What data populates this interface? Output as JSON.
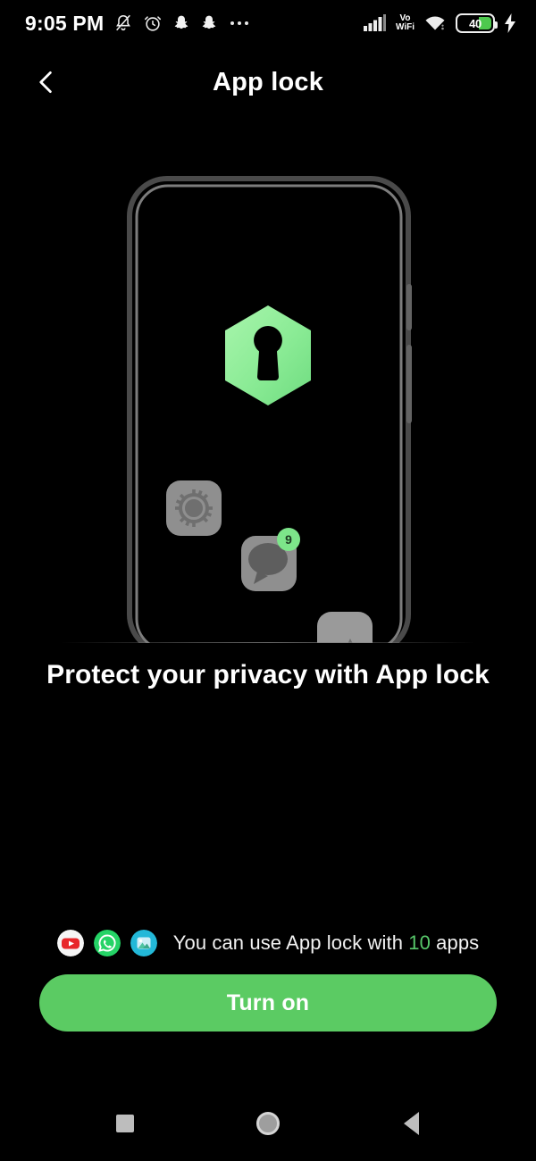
{
  "statusbar": {
    "time": "9:05 PM",
    "battery_level": "40",
    "vo_line1": "Vo",
    "vo_line2": "WiFi",
    "icons": [
      "bell-muted-icon",
      "alarm-clock-icon",
      "snapchat-icon",
      "snapchat-icon",
      "overflow-dots-icon",
      "signal-bars-icon",
      "volte-wifi-icon",
      "wifi-icon",
      "battery-icon",
      "charging-bolt-icon"
    ]
  },
  "header": {
    "title": "App lock",
    "back_icon": "chevron-left-icon"
  },
  "illustration": {
    "shield_icon": "shield-keyhole-icon",
    "app_tiles": [
      {
        "name": "settings-gear-icon"
      },
      {
        "name": "messages-bubble-icon",
        "badge": "9"
      },
      {
        "name": "gallery-icon"
      }
    ]
  },
  "main": {
    "headline": "Protect your privacy with App lock"
  },
  "footer": {
    "text_before": "You can use App lock with",
    "app_count": "10",
    "text_after": "apps",
    "app_icons": [
      "youtube-icon",
      "whatsapp-icon",
      "gallery-icon"
    ],
    "button_label": "Turn on"
  },
  "navbar": {
    "recents_label": "Recents",
    "home_label": "Home",
    "back_label": "Back"
  },
  "colors": {
    "accent_green": "#5bcb63",
    "shield_green": "#8fee9a",
    "count_green": "#57c76a",
    "background": "#000000"
  }
}
